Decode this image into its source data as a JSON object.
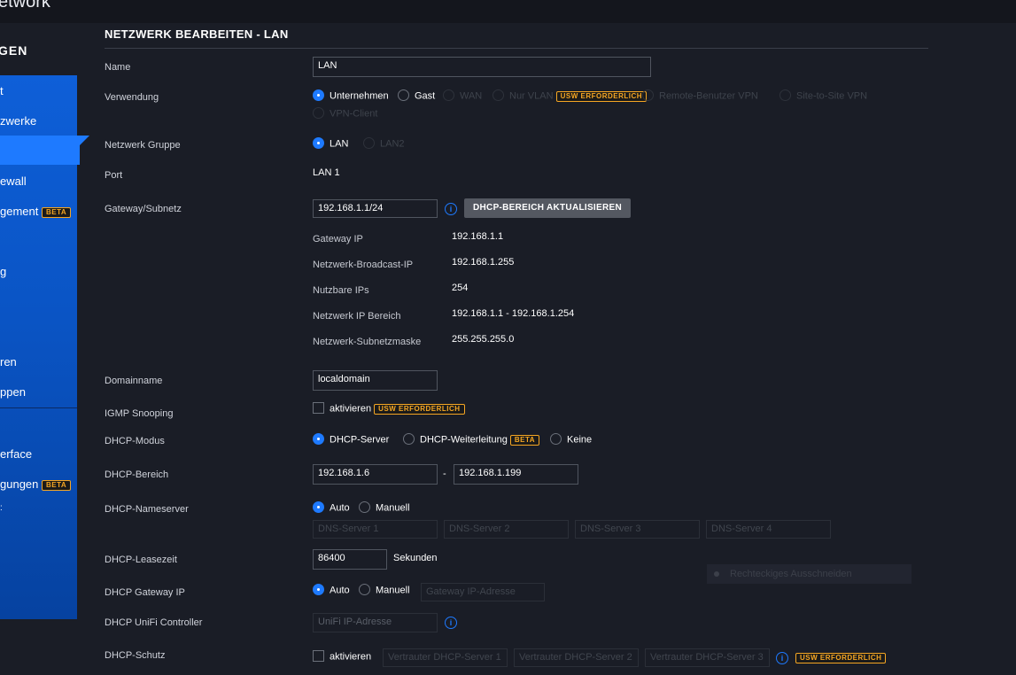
{
  "app": {
    "title": "etwork"
  },
  "sidebar": {
    "heading": "GEN",
    "items": [
      {
        "label": "t"
      },
      {
        "label": "zwerke"
      },
      {
        "label": "ewall"
      },
      {
        "label": "gement",
        "badge": "BETA"
      },
      {
        "label": "g"
      },
      {
        "label": "ren"
      },
      {
        "label": "ppen"
      },
      {
        "label": "erface"
      },
      {
        "label": "gungen",
        "badge": "BETA"
      },
      {
        "label": ":"
      }
    ]
  },
  "form": {
    "title": "NETZWERK BEARBEITEN - LAN",
    "name": {
      "label": "Name",
      "value": "LAN"
    },
    "usage": {
      "label": "Verwendung",
      "options": [
        "Unternehmen",
        "Gast",
        "WAN",
        "Nur VLAN",
        "Remote-Benutzer VPN",
        "Site-to-Site VPN",
        "VPN-Client"
      ],
      "usw_badge": "USW ERFORDERLICH"
    },
    "group": {
      "label": "Netzwerk Gruppe",
      "options": [
        "LAN",
        "LAN2"
      ]
    },
    "port": {
      "label": "Port",
      "value": "LAN 1"
    },
    "gateway": {
      "label": "Gateway/Subnetz",
      "value": "192.168.1.1/24",
      "button": "DHCP-BEREICH AKTUALISIEREN",
      "details": [
        {
          "label": "Gateway IP",
          "value": "192.168.1.1"
        },
        {
          "label": "Netzwerk-Broadcast-IP",
          "value": "192.168.1.255"
        },
        {
          "label": "Nutzbare IPs",
          "value": "254"
        },
        {
          "label": "Netzwerk IP Bereich",
          "value": "192.168.1.1 - 192.168.1.254"
        },
        {
          "label": "Netzwerk-Subnetzmaske",
          "value": "255.255.255.0"
        }
      ]
    },
    "domain": {
      "label": "Domainname",
      "value": "localdomain"
    },
    "igmp": {
      "label": "IGMP Snooping",
      "check": "aktivieren",
      "badge": "USW ERFORDERLICH"
    },
    "dhcp_mode": {
      "label": "DHCP-Modus",
      "options": [
        "DHCP-Server",
        "DHCP-Weiterleitung",
        "Keine"
      ],
      "badge": "BETA"
    },
    "dhcp_range": {
      "label": "DHCP-Bereich",
      "start": "192.168.1.6",
      "sep": "-",
      "end": "192.168.1.199"
    },
    "nameserver": {
      "label": "DHCP-Nameserver",
      "options": [
        "Auto",
        "Manuell"
      ],
      "placeholders": [
        "DNS-Server 1",
        "DNS-Server 2",
        "DNS-Server 3",
        "DNS-Server 4"
      ]
    },
    "lease": {
      "label": "DHCP-Leasezeit",
      "value": "86400",
      "unit": "Sekunden"
    },
    "gw_ip": {
      "label": "DHCP Gateway IP",
      "options": [
        "Auto",
        "Manuell"
      ],
      "placeholder": "Gateway IP-Adresse"
    },
    "controller": {
      "label": "DHCP UniFi Controller",
      "placeholder": "UniFi IP-Adresse"
    },
    "guard": {
      "label": "DHCP-Schutz",
      "check": "aktivieren",
      "placeholders": [
        "Vertrauter DHCP-Server 1",
        "Vertrauter DHCP-Server 2",
        "Vertrauter DHCP-Server 3"
      ],
      "badge": "USW ERFORDERLICH"
    }
  },
  "overlay": {
    "label": "Rechteckiges Ausschneiden"
  }
}
